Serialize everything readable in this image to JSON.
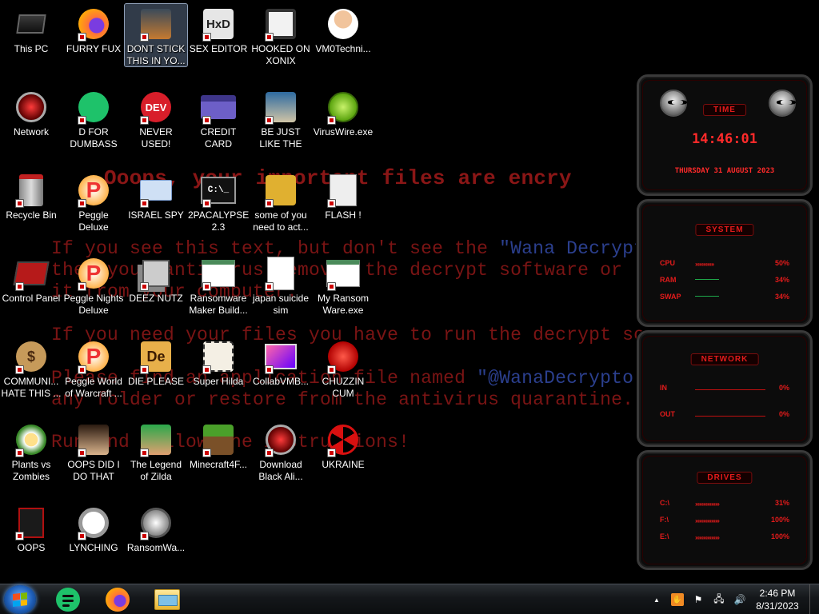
{
  "wallpaper": {
    "line_title": "Ooops, your important files are encry",
    "line1_a": "If you see this text, but don't see the ",
    "line1_b": "\"Wana Decrypt",
    "line2": "then your antivirus removed the decrypt software or",
    "line3": "it from your computer.",
    "line4": "If you need your files you have to run the decrypt so",
    "line5_a": "Please find an application file named ",
    "line5_b": "\"@WanaDecrypto",
    "line6": "any folder or restore from the antivirus quarantine.",
    "line7": "Run and follow the instructions!"
  },
  "icons": [
    {
      "label": "This PC",
      "icon": "computer-icon"
    },
    {
      "label": "FURRY FUX",
      "icon": "firefox-icon"
    },
    {
      "label": "DONT STICK THIS IN YO...",
      "icon": "dragon-icon"
    },
    {
      "label": "SEX EDITOR",
      "icon": "hxd-icon"
    },
    {
      "label": "HOOKED ON XONIX",
      "icon": "xonix-icon"
    },
    {
      "label": "VM0Techni...",
      "icon": "doctor-icon"
    },
    {
      "label": "Network",
      "icon": "network-icon"
    },
    {
      "label": "D FOR DUMBASS",
      "icon": "notes-icon"
    },
    {
      "label": "NEVER USED!",
      "icon": "devcpp-icon"
    },
    {
      "label": "CREDIT CARD CHECKER",
      "icon": "credit-card-icon"
    },
    {
      "label": "BE JUST LIKE THE DUDE!",
      "icon": "gnome-icon"
    },
    {
      "label": "VirusWire.exe",
      "icon": "limewire-icon"
    },
    {
      "label": "Recycle Bin",
      "icon": "recycle-bin-icon"
    },
    {
      "label": "Peggle Deluxe",
      "icon": "peggle-icon"
    },
    {
      "label": "ISRAEL SPY",
      "icon": "spy-icon"
    },
    {
      "label": "2PACALYPSE 2.3",
      "icon": "terminal-icon"
    },
    {
      "label": "some of you need to act...",
      "icon": "dog-icon"
    },
    {
      "label": "FLASH !",
      "icon": "flash-icon"
    },
    {
      "label": "Control Panel",
      "icon": "control-panel-icon"
    },
    {
      "label": "Peggle Nights Deluxe",
      "icon": "peggle-icon"
    },
    {
      "label": "DEEZ NUTZ",
      "icon": "windows-stack-icon"
    },
    {
      "label": "Ransomware Maker Build...",
      "icon": "app-window-icon"
    },
    {
      "label": "japan suicide sim",
      "icon": "document-icon"
    },
    {
      "label": "My Ransom Ware.exe",
      "icon": "app-window-icon"
    },
    {
      "label": "COMMUNI... HATE THIS ...",
      "icon": "money-bag-icon"
    },
    {
      "label": "Peggle World of Warcraft ...",
      "icon": "peggle-icon"
    },
    {
      "label": "DIE PLEASE",
      "icon": "after-effects-icon"
    },
    {
      "label": "Super Hilda",
      "icon": "pixel-character-icon"
    },
    {
      "label": "CollabVMB...",
      "icon": "monitor-icon"
    },
    {
      "label": "CHUZZIN CUM",
      "icon": "chuzzle-icon"
    },
    {
      "label": "Plants vs Zombies",
      "icon": "flower-icon"
    },
    {
      "label": "OOPS DID I DO THAT",
      "icon": "portrait-icon"
    },
    {
      "label": "The Legend of Zilda",
      "icon": "zelda-icon"
    },
    {
      "label": "Minecraft4F...",
      "icon": "grass-block-icon"
    },
    {
      "label": "Download Black Ali...",
      "icon": "alienware-icon"
    },
    {
      "label": "UKRAINE",
      "icon": "radiation-icon"
    },
    {
      "label": "OOPS",
      "icon": "alien-app-icon"
    },
    {
      "label": "LYNCHING",
      "icon": "knot-icon"
    },
    {
      "label": "RansomWa...",
      "icon": "skull-icon"
    }
  ],
  "widgets": {
    "time": {
      "title": "TIME",
      "clock": "14:46:01",
      "date": "THURSDAY 31 AUGUST 2023"
    },
    "system": {
      "title": "SYSTEM",
      "rows": [
        {
          "k": "CPU",
          "v": "50%"
        },
        {
          "k": "RAM",
          "v": "34%"
        },
        {
          "k": "SWAP",
          "v": "34%"
        }
      ]
    },
    "network": {
      "title": "NETWORK",
      "rows": [
        {
          "k": "IN",
          "v": "0%"
        },
        {
          "k": "OUT",
          "v": "0%"
        }
      ]
    },
    "drives": {
      "title": "DRIVES",
      "rows": [
        {
          "k": "C:\\",
          "v": "31%"
        },
        {
          "k": "F:\\",
          "v": "100%"
        },
        {
          "k": "E:\\",
          "v": "100%"
        }
      ]
    }
  },
  "taskbar": {
    "clock_time": "2:46 PM",
    "clock_date": "8/31/2023",
    "pinned": [
      "notes-icon",
      "firefox-icon",
      "folder-icon"
    ]
  }
}
